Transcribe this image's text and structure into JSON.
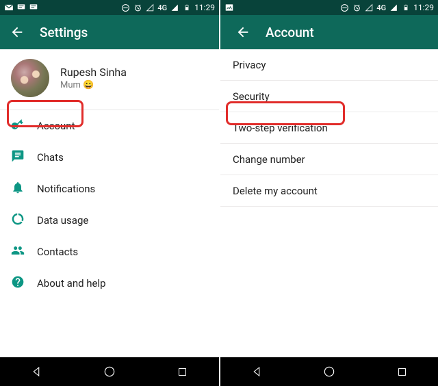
{
  "statusbar": {
    "network_label": "4G",
    "time": "11:29"
  },
  "left": {
    "appbar_title": "Settings",
    "profile": {
      "name": "Rupesh Sinha",
      "status_text": "Mum ",
      "status_emoji": "😀"
    },
    "items": [
      {
        "label": "Account"
      },
      {
        "label": "Chats"
      },
      {
        "label": "Notifications"
      },
      {
        "label": "Data usage"
      },
      {
        "label": "Contacts"
      },
      {
        "label": "About and help"
      }
    ]
  },
  "right": {
    "appbar_title": "Account",
    "items": [
      {
        "label": "Privacy"
      },
      {
        "label": "Security"
      },
      {
        "label": "Two-step verification"
      },
      {
        "label": "Change number"
      },
      {
        "label": "Delete my account"
      }
    ]
  }
}
